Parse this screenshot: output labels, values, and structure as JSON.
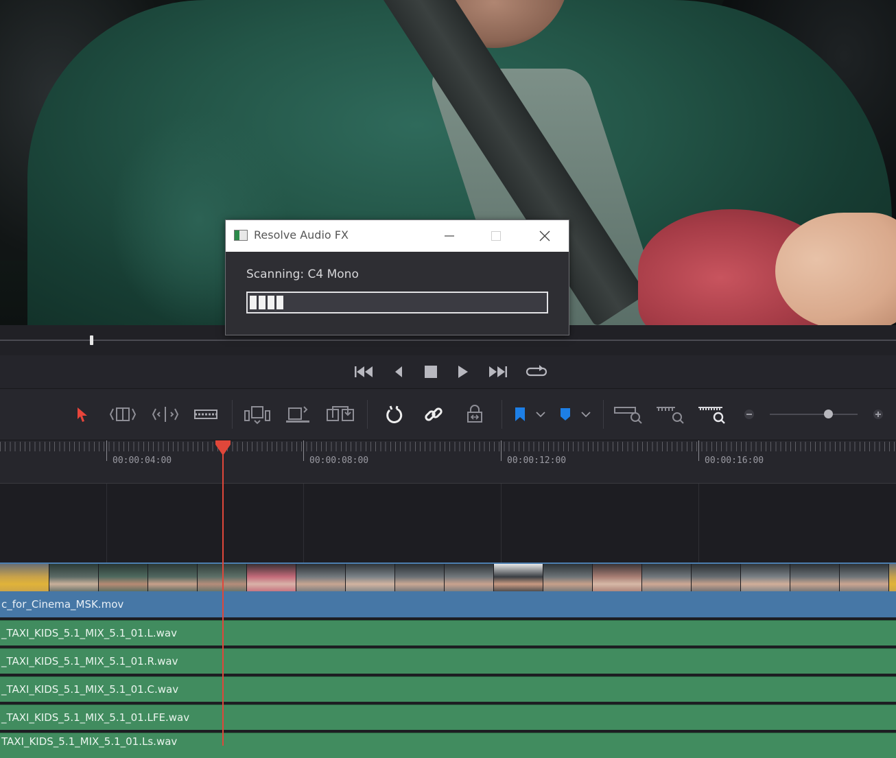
{
  "dialog": {
    "title": "Resolve Audio FX",
    "status_text": "Scanning: C4 Mono",
    "progress": 0.12
  },
  "ruler": {
    "timecodes": [
      "00:00:04:00",
      "00:00:08:00",
      "00:00:12:00",
      "00:00:16:00"
    ]
  },
  "tracks": {
    "video_clip": "c_for_Cinema_MSK.mov",
    "audio_clips": [
      "_TAXI_KIDS_5.1_MIX_5.1_01.L.wav",
      "_TAXI_KIDS_5.1_MIX_5.1_01.R.wav",
      "_TAXI_KIDS_5.1_MIX_5.1_01.C.wav",
      "_TAXI_KIDS_5.1_MIX_5.1_01.LFE.wav",
      "TAXI_KIDS_5.1_MIX_5.1_01.Ls.wav"
    ]
  },
  "colors": {
    "accent_playhead": "#e0473a",
    "video_track": "#4677a6",
    "audio_track": "#418c5f",
    "flag_blue": "#1d7fe6"
  },
  "icons": [
    "go-to-start-icon",
    "step-back-icon",
    "stop-icon",
    "play-icon",
    "go-to-end-icon",
    "loop-icon",
    "selection-arrow-icon",
    "trim-edit-icon",
    "dynamic-trim-icon",
    "blade-icon",
    "insert-clip-icon",
    "overwrite-clip-icon",
    "replace-clip-icon",
    "snapping-icon",
    "linked-selection-icon",
    "position-lock-icon",
    "flag-icon",
    "chevron-down-icon",
    "marker-icon",
    "full-zoom-icon",
    "detail-zoom-icon",
    "custom-zoom-icon",
    "zoom-out-icon",
    "zoom-in-icon"
  ]
}
